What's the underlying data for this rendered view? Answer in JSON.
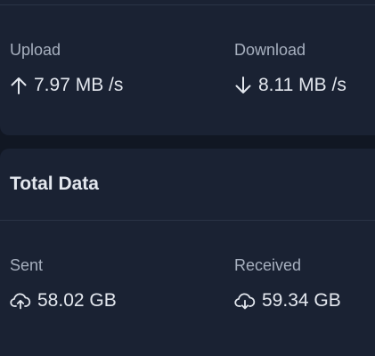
{
  "speed": {
    "upload": {
      "label": "Upload",
      "value": "7.97 MB /s",
      "icon": "arrow-up-icon"
    },
    "download": {
      "label": "Download",
      "value": "8.11 MB /s",
      "icon": "arrow-down-icon"
    }
  },
  "total_data": {
    "title": "Total Data",
    "sent": {
      "label": "Sent",
      "value": "58.02 GB",
      "icon": "cloud-upload-icon"
    },
    "received": {
      "label": "Received",
      "value": "59.34 GB",
      "icon": "cloud-download-icon"
    }
  },
  "colors": {
    "background": "#111723",
    "card": "#1a2233",
    "text_primary": "#e3e7ee",
    "text_secondary": "#a7b0bf",
    "divider": "#2a3446"
  }
}
